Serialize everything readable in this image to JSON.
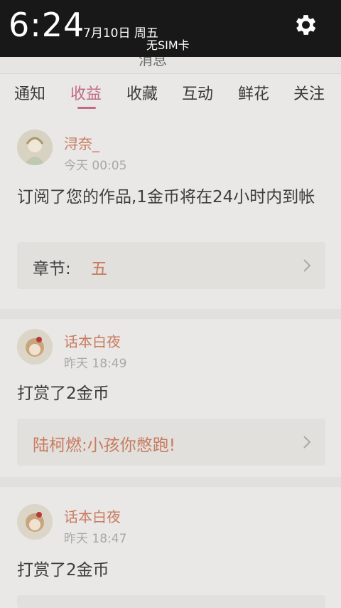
{
  "statusbar": {
    "time": "6:24",
    "date": "7月10日 周五",
    "carrier": "无SIM卡",
    "settings_icon": "gear-icon"
  },
  "header": {
    "title_peek": "消息"
  },
  "tabs": [
    {
      "label": "通知",
      "active": false
    },
    {
      "label": "收益",
      "active": true
    },
    {
      "label": "收藏",
      "active": false
    },
    {
      "label": "互动",
      "active": false
    },
    {
      "label": "鲜花",
      "active": false
    },
    {
      "label": "关注",
      "active": false
    }
  ],
  "feed": [
    {
      "name": "浔奈_",
      "time": "今天 00:05",
      "message": "订阅了您的作品,1金币将在24小时内到帐",
      "quote_label": "章节:",
      "quote_value": "五"
    },
    {
      "name": "话本白夜",
      "time": "昨天 18:49",
      "message": "打赏了2金币",
      "quote_label": "",
      "quote_value": "陆柯燃:小孩你憋跑!"
    },
    {
      "name": "话本白夜",
      "time": "昨天 18:47",
      "message": "打赏了2金币",
      "quote_label": "",
      "quote_value": ""
    }
  ],
  "colors": {
    "accent": "#c26a86",
    "name": "#c97a5f"
  }
}
